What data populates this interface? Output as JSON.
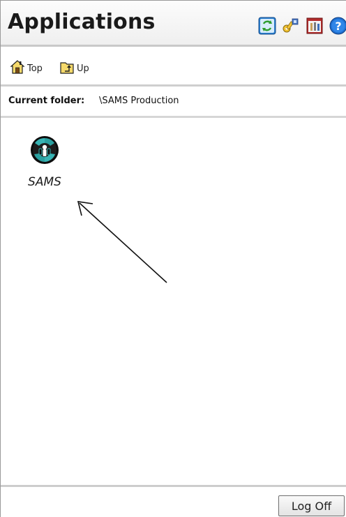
{
  "header": {
    "title": "Applications",
    "icons": [
      "refresh-icon",
      "key-icon",
      "settings-icon",
      "help-icon"
    ]
  },
  "nav": {
    "top_label": "Top",
    "up_label": "Up"
  },
  "folder": {
    "label": "Current folder:",
    "value": "\\SAMS Production"
  },
  "apps": [
    {
      "label": "SAMS",
      "icon": "sams-app-icon"
    }
  ],
  "footer": {
    "logoff_label": "Log Off"
  },
  "colors": {
    "header_bg": "#f4f4f4",
    "divider": "#cccccc",
    "text": "#111111"
  }
}
